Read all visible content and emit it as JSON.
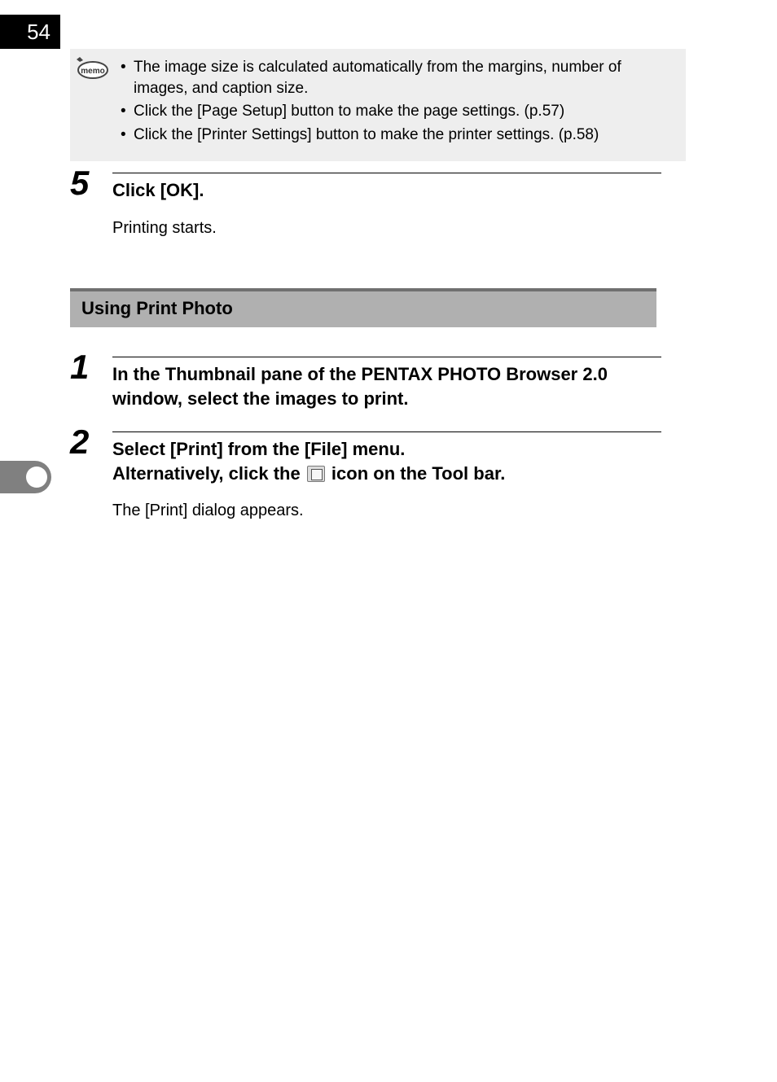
{
  "page_number": "54",
  "memo": {
    "icon_label": "memo",
    "items": [
      "The image size is calculated automatically from the margins, number of images, and caption size.",
      "Click the [Page Setup] button to make the page settings. (p.57)",
      "Click the [Printer Settings] button to make the printer settings. (p.58)"
    ]
  },
  "step5": {
    "num": "5",
    "head": "Click [OK].",
    "body": "Printing starts."
  },
  "section_title": "Using Print Photo",
  "step1": {
    "num": "1",
    "head": "In the Thumbnail pane of the PENTAX PHOTO Browser 2.0 window, select the images to print."
  },
  "step2": {
    "num": "2",
    "head_a": "Select [Print] from the [File] menu.",
    "head_b1": "Alternatively, click the ",
    "head_b2": " icon on the Tool bar.",
    "body": "The [Print] dialog appears."
  }
}
